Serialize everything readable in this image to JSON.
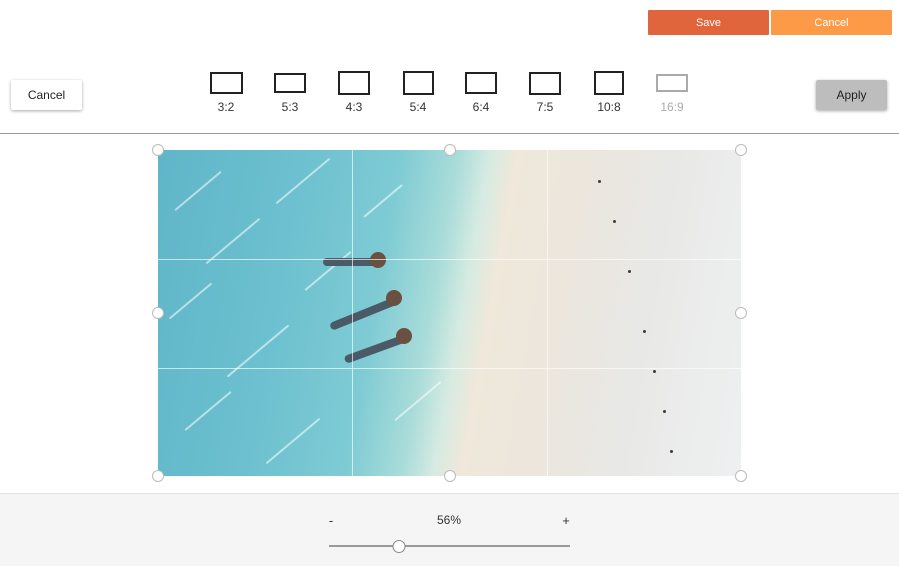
{
  "top_bar": {
    "save_label": "Save",
    "cancel_label": "Cancel"
  },
  "toolbar": {
    "cancel_label": "Cancel",
    "apply_label": "Apply"
  },
  "aspect_ratios": [
    {
      "label": "3:2",
      "enabled": true
    },
    {
      "label": "5:3",
      "enabled": true
    },
    {
      "label": "4:3",
      "enabled": true
    },
    {
      "label": "5:4",
      "enabled": true
    },
    {
      "label": "6:4",
      "enabled": true
    },
    {
      "label": "7:5",
      "enabled": true
    },
    {
      "label": "10:8",
      "enabled": true
    },
    {
      "label": "16:9",
      "enabled": false
    }
  ],
  "zoom": {
    "minus_label": "-",
    "plus_label": "+",
    "value_label": "56%",
    "level": 0.29
  },
  "colors": {
    "save": "#e0643c",
    "cancel_top": "#fd9a47",
    "apply": "#bdbdbd"
  }
}
